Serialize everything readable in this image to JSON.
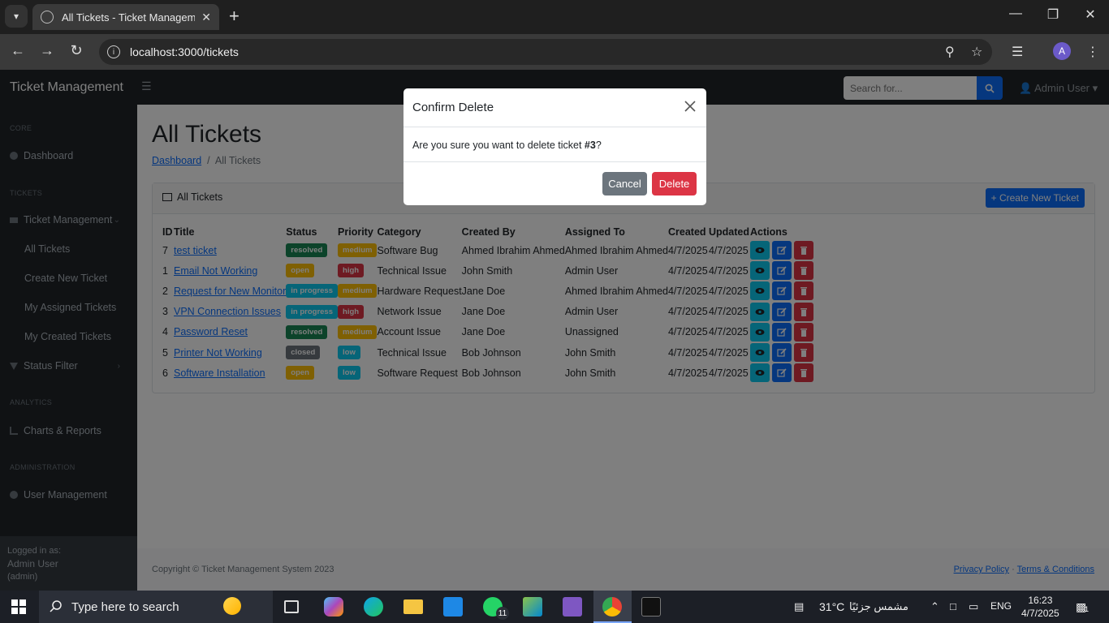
{
  "browser": {
    "tab_title": "All Tickets - Ticket Management",
    "url": "localhost:3000/tickets",
    "profile_initial": "A"
  },
  "app": {
    "brand": "Ticket Management",
    "search_placeholder": "Search for...",
    "user_menu": "Admin User"
  },
  "sidebar": {
    "core_heading": "CORE",
    "dashboard": "Dashboard",
    "tickets_heading": "TICKETS",
    "ticket_management": "Ticket Management",
    "all_tickets": "All Tickets",
    "create_new_ticket": "Create New Ticket",
    "my_assigned": "My Assigned Tickets",
    "my_created": "My Created Tickets",
    "status_filter": "Status Filter",
    "analytics_heading": "ANALYTICS",
    "charts_reports": "Charts & Reports",
    "administration_heading": "ADMINISTRATION",
    "user_management": "User Management",
    "logged_in_as": "Logged in as:",
    "logged_user": "Admin User",
    "logged_role": "(admin)"
  },
  "main": {
    "title": "All Tickets",
    "breadcrumb_home": "Dashboard",
    "breadcrumb_sep": "/",
    "breadcrumb_current": "All Tickets",
    "card_title": "All Tickets",
    "create_button": "+ Create New Ticket",
    "columns": [
      "ID",
      "Title",
      "Status",
      "Priority",
      "Category",
      "Created By",
      "Assigned To",
      "Created",
      "Updated",
      "Actions"
    ],
    "rows": [
      {
        "id": "7",
        "title": "test ticket",
        "status": "resolved",
        "priority": "medium",
        "category": "Software Bug",
        "created_by": "Ahmed Ibrahim Ahmed",
        "assigned_to": "Ahmed Ibrahim Ahmed",
        "created": "4/7/2025",
        "updated": "4/7/2025"
      },
      {
        "id": "1",
        "title": "Email Not Working",
        "status": "open",
        "priority": "high",
        "category": "Technical Issue",
        "created_by": "John Smith",
        "assigned_to": "Admin User",
        "created": "4/7/2025",
        "updated": "4/7/2025"
      },
      {
        "id": "2",
        "title": "Request for New Monitor",
        "status": "in progress",
        "priority": "medium",
        "category": "Hardware Request",
        "created_by": "Jane Doe",
        "assigned_to": "Ahmed Ibrahim Ahmed",
        "created": "4/7/2025",
        "updated": "4/7/2025"
      },
      {
        "id": "3",
        "title": "VPN Connection Issues",
        "status": "in progress",
        "priority": "high",
        "category": "Network Issue",
        "created_by": "Jane Doe",
        "assigned_to": "Admin User",
        "created": "4/7/2025",
        "updated": "4/7/2025"
      },
      {
        "id": "4",
        "title": "Password Reset",
        "status": "resolved",
        "priority": "medium",
        "category": "Account Issue",
        "created_by": "Jane Doe",
        "assigned_to": "Unassigned",
        "created": "4/7/2025",
        "updated": "4/7/2025"
      },
      {
        "id": "5",
        "title": "Printer Not Working",
        "status": "closed",
        "priority": "low",
        "category": "Technical Issue",
        "created_by": "Bob Johnson",
        "assigned_to": "John Smith",
        "created": "4/7/2025",
        "updated": "4/7/2025"
      },
      {
        "id": "6",
        "title": "Software Installation",
        "status": "open",
        "priority": "low",
        "category": "Software Request",
        "created_by": "Bob Johnson",
        "assigned_to": "John Smith",
        "created": "4/7/2025",
        "updated": "4/7/2025"
      }
    ],
    "status_colors": {
      "resolved": "#198754",
      "open": "#ffc107",
      "in progress": "#0dcaf0",
      "closed": "#6c757d"
    },
    "priority_colors": {
      "medium": "#ffc107",
      "high": "#dc3545",
      "low": "#0dcaf0"
    }
  },
  "footer": {
    "copyright": "Copyright © Ticket Management System 2023",
    "privacy": "Privacy Policy",
    "sep": "·",
    "terms": "Terms & Conditions"
  },
  "modal": {
    "title": "Confirm Delete",
    "body_prefix": "Are you sure you want to delete ticket ",
    "ticket_ref": "#3",
    "body_suffix": "?",
    "cancel": "Cancel",
    "delete": "Delete"
  },
  "taskbar": {
    "search_placeholder": "Type here to search",
    "whatsapp_badge": "11",
    "temperature": "31°C",
    "weather_text": "مشمس جزئيًا",
    "language": "ENG",
    "time": "16:23",
    "date": "4/7/2025",
    "notification_count": "1"
  }
}
